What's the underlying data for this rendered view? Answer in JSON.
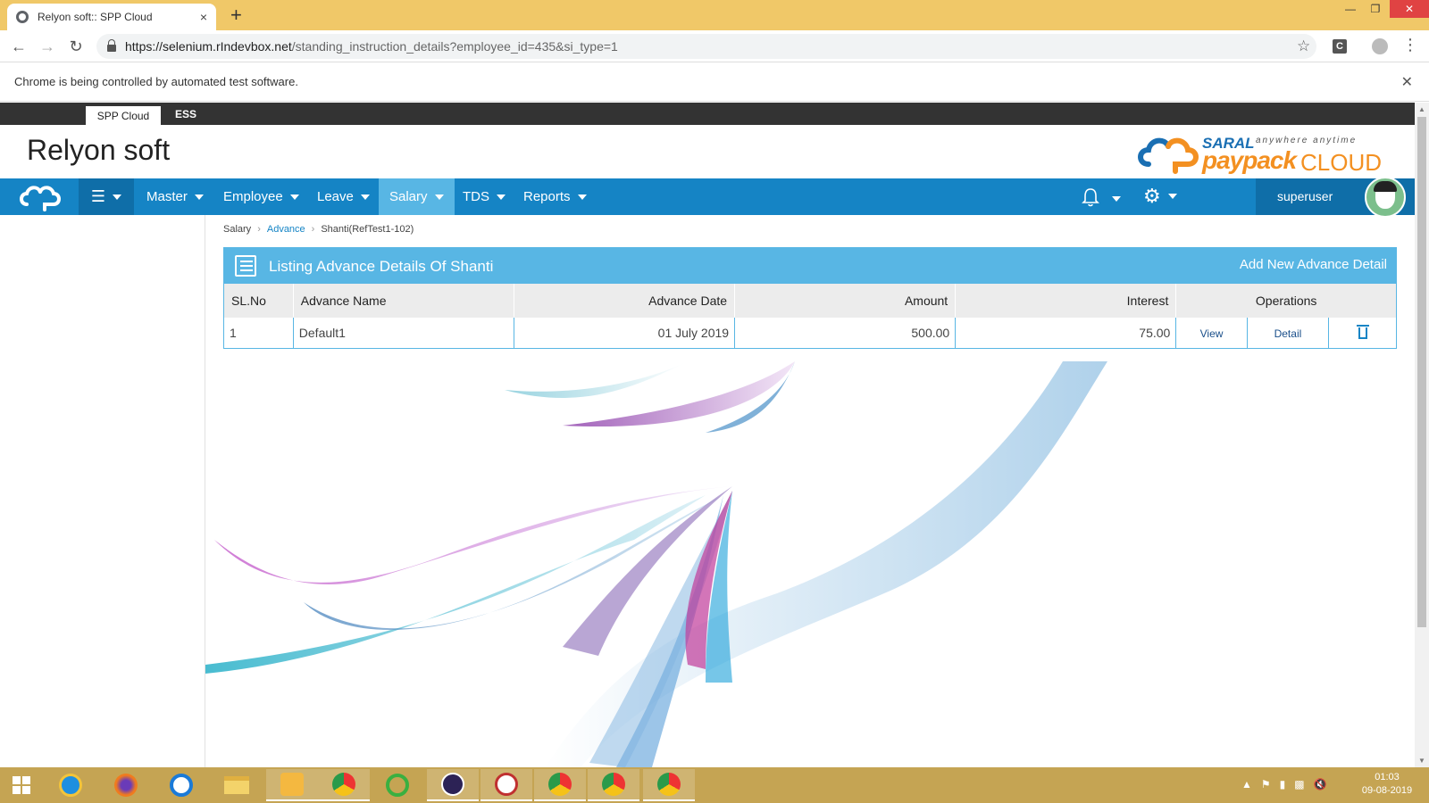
{
  "browser": {
    "tab_title": "Relyon soft:: SPP Cloud",
    "tab_close": "×",
    "new_tab": "+",
    "url_host": "https://selenium.rIndevbox.net",
    "url_path": "/standing_instruction_details?employee_id=435&si_type=1",
    "infobar_text": "Chrome is being controlled by automated test software.",
    "extension_label": "C"
  },
  "top_tabs": [
    "SPP Cloud",
    "ESS"
  ],
  "brand": {
    "company_name": "Relyon soft",
    "logo_saral": "SARAL",
    "logo_tagline": "anywhere anytime",
    "logo_paypack": "paypack",
    "logo_cloud": "CLOUD"
  },
  "nav": {
    "items": [
      "Master",
      "Employee",
      "Leave",
      "Salary",
      "TDS",
      "Reports"
    ],
    "active": "Salary",
    "username": "superuser"
  },
  "breadcrumb": [
    "Salary",
    "Advance",
    "Shanti(RefTest1-102)"
  ],
  "panel": {
    "title": "Listing Advance Details Of Shanti",
    "add_link": "Add New Advance Detail"
  },
  "table": {
    "headers": [
      "SL.No",
      "Advance Name",
      "Advance Date",
      "Amount",
      "Interest",
      "Operations"
    ],
    "rows": [
      {
        "sl": "1",
        "name": "Default1",
        "date": "01 July 2019",
        "amount": "500.00",
        "interest": "75.00",
        "view": "View",
        "detail": "Detail"
      }
    ]
  },
  "taskbar": {
    "time": "01:03",
    "date": "09-08-2019"
  },
  "colors": {
    "nav_blue": "#1584c5",
    "panel_blue": "#58b6e4",
    "chrome_frame": "#f0c868",
    "taskbar": "#c5a453"
  }
}
